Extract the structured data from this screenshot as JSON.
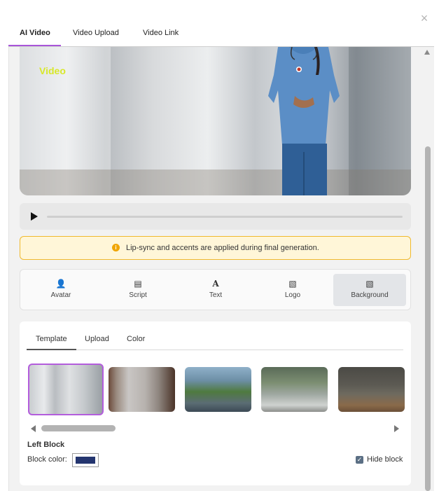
{
  "tabs": [
    {
      "label": "AI Video",
      "active": true
    },
    {
      "label": "Video Upload",
      "active": false
    },
    {
      "label": "Video Link",
      "active": false
    }
  ],
  "close_icon": "close-icon",
  "video": {
    "overlay_text": "Video",
    "overlay_color": "#d8e82a"
  },
  "player": {
    "play_icon": "play-icon",
    "progress": 0
  },
  "notice": {
    "icon": "info-icon",
    "text": "Lip-sync and accents are applied during final generation."
  },
  "toolbar": {
    "items": [
      {
        "label": "Avatar",
        "icon": "person-icon",
        "glyph": "👤"
      },
      {
        "label": "Script",
        "icon": "document-icon",
        "glyph": "▤"
      },
      {
        "label": "Text",
        "icon": "text-icon",
        "glyph": "A"
      },
      {
        "label": "Logo",
        "icon": "image-icon",
        "glyph": "▧"
      },
      {
        "label": "Background",
        "icon": "image-icon",
        "glyph": "▧",
        "active": true
      }
    ]
  },
  "background_panel": {
    "subtabs": [
      {
        "label": "Template",
        "active": true
      },
      {
        "label": "Upload",
        "active": false
      },
      {
        "label": "Color",
        "active": false
      }
    ],
    "thumbnails_selected_index": 0,
    "left_block": {
      "title": "Left Block",
      "color_label": "Block color:",
      "color": "#24356f",
      "hide_label": "Hide block",
      "hide_checked": true
    }
  },
  "colors": {
    "accent": "#a855d9",
    "notice_border": "#f0b92d",
    "notice_bg": "#fff6d8"
  }
}
